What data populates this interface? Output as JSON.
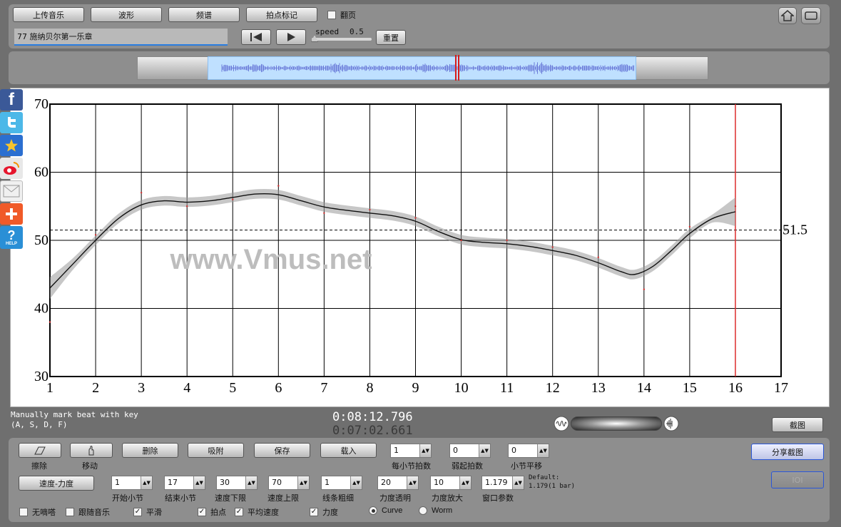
{
  "toolbar": {
    "upload_label": "上传音乐",
    "waveform_label": "波形",
    "spectrum_label": "频谱",
    "beat_mark_label": "拍点标记",
    "page_flip_label": "翻页",
    "track_title": "77 施纳贝尔第一乐章",
    "speed_label": "speed",
    "speed_value": "0.5",
    "reset_label": "重置"
  },
  "chart_data": {
    "type": "line",
    "xlabel": "",
    "ylabel": "",
    "xlim": [
      1,
      17
    ],
    "ylim": [
      30,
      70
    ],
    "x_ticks": [
      "1",
      "2",
      "3",
      "4",
      "5",
      "6",
      "7",
      "8",
      "9",
      "10",
      "11",
      "12",
      "13",
      "14",
      "15",
      "16",
      "17"
    ],
    "y_ticks": [
      "70",
      "60",
      "50",
      "40",
      "30"
    ],
    "mean_line_label": "51.5",
    "mean_value": 51.5,
    "cursor_x": 16,
    "watermark": "www.Vmus.net",
    "grid": true,
    "series": [
      {
        "x": [
          1,
          1.5,
          2,
          2.5,
          3,
          3.5,
          4,
          4.5,
          5,
          5.5,
          6,
          6.5,
          7,
          7.5,
          8,
          8.5,
          9,
          9.5,
          10,
          10.5,
          11,
          11.5,
          12,
          12.5,
          13,
          13.5,
          13.8,
          14.2,
          14.6,
          15,
          15.5,
          16
        ],
        "y": [
          43,
          46.5,
          50,
          53.2,
          55.2,
          55.8,
          55.6,
          55.8,
          56.3,
          56.8,
          56.7,
          55.8,
          54.9,
          54.4,
          54,
          53.6,
          52.8,
          51.3,
          50.1,
          49.7,
          49.5,
          49.1,
          48.5,
          47.8,
          46.7,
          45.4,
          45,
          46.2,
          48.5,
          51,
          53.2,
          54.2
        ]
      }
    ],
    "beat_points": [
      {
        "x": 1,
        "y": 38
      },
      {
        "x": 2,
        "y": 50.8
      },
      {
        "x": 3,
        "y": 57
      },
      {
        "x": 4,
        "y": 55
      },
      {
        "x": 5,
        "y": 56
      },
      {
        "x": 6,
        "y": 58
      },
      {
        "x": 7,
        "y": 54
      },
      {
        "x": 8,
        "y": 54.5
      },
      {
        "x": 9,
        "y": 53.3
      },
      {
        "x": 10,
        "y": 50
      },
      {
        "x": 11,
        "y": 50
      },
      {
        "x": 12,
        "y": 49
      },
      {
        "x": 13,
        "y": 47.5
      },
      {
        "x": 14,
        "y": 42.8
      },
      {
        "x": 15,
        "y": 52
      },
      {
        "x": 16,
        "y": 55
      }
    ]
  },
  "status": {
    "hint_line1": "Manually mark beat with key",
    "hint_line2": "(A, S, D, F)",
    "time_total": "0:08:12.796",
    "time_current": "0:07:02.661",
    "screenshot_label": "截图"
  },
  "controls": {
    "erase_label": "擦除",
    "move_label": "移动",
    "delete_label": "删除",
    "snap_label": "吸附",
    "save_label": "保存",
    "load_label": "载入",
    "beats_per_bar_value": "1",
    "beats_per_bar_label": "每小节拍数",
    "pickup_value": "0",
    "pickup_label": "弱起拍数",
    "bar_shift_value": "0",
    "bar_shift_label": "小节平移",
    "share_label": "分享截图",
    "ioi_label": "IOI",
    "tempo_dynamics_label": "速度-力度",
    "start_bar_value": "1",
    "start_bar_label": "开始小节",
    "end_bar_value": "17",
    "end_bar_label": "结束小节",
    "tempo_min_value": "30",
    "tempo_min_label": "速度下限",
    "tempo_max_value": "70",
    "tempo_max_label": "速度上限",
    "line_width_value": "1",
    "line_width_label": "线条粗细",
    "dyn_alpha_value": "20",
    "dyn_alpha_label": "力度透明",
    "dyn_scale_value": "10",
    "dyn_scale_label": "力度放大",
    "window_value": "1.179",
    "window_label": "窗口参数",
    "default_line1": "Default:",
    "default_line2": "1.179(1 bar)",
    "metronome_label": "无嘀嗒",
    "follow_label": "跟随音乐",
    "smooth_label": "平滑",
    "beats_label": "拍点",
    "avg_tempo_label": "平均速度",
    "dynamics_label": "力度",
    "curve_label": "Curve",
    "worm_label": "Worm"
  },
  "social": {
    "facebook": "f",
    "help": "HELP"
  }
}
